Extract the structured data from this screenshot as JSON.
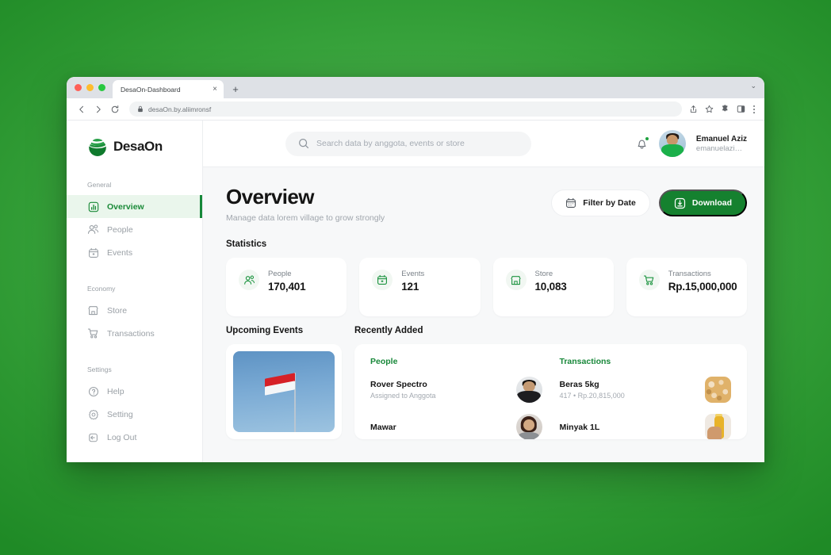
{
  "browser": {
    "tab_title": "DesaOn-Dashboard",
    "tab_close": "×",
    "new_tab": "+",
    "tabstrip_chevron": "⌄",
    "url": "desaOn.by.aliimronsf",
    "icons": {
      "back": "back-arrow-icon",
      "forward": "forward-arrow-icon",
      "reload": "reload-icon",
      "lock": "lock-icon",
      "share": "share-icon",
      "bookmark": "star-icon",
      "extensions": "puzzle-icon",
      "sidepanel": "side-panel-icon",
      "menu": "kebab-menu-icon"
    }
  },
  "brand": {
    "name": "DesaOn",
    "logo_color": "#17883a"
  },
  "sidebar": {
    "groups": [
      {
        "label": "General",
        "items": [
          {
            "label": "Overview",
            "icon": "chart-bar-icon",
            "active": true
          },
          {
            "label": "People",
            "icon": "people-icon",
            "active": false
          },
          {
            "label": "Events",
            "icon": "calendar-icon",
            "active": false
          }
        ]
      },
      {
        "label": "Economy",
        "items": [
          {
            "label": "Store",
            "icon": "store-icon",
            "active": false
          },
          {
            "label": "Transactions",
            "icon": "cart-icon",
            "active": false
          }
        ]
      },
      {
        "label": "Settings",
        "items": [
          {
            "label": "Help",
            "icon": "question-circle-icon",
            "active": false
          },
          {
            "label": "Setting",
            "icon": "gear-icon",
            "active": false
          },
          {
            "label": "Log Out",
            "icon": "logout-icon",
            "active": false
          }
        ]
      }
    ]
  },
  "topbar": {
    "search_placeholder": "Search data by anggota, events or store",
    "search_icon": "search-icon",
    "notification_icon": "bell-icon",
    "user": {
      "name": "Emanuel Aziz",
      "handle": "emanuelazi…"
    }
  },
  "page": {
    "title": "Overview",
    "subtitle": "Manage data  lorem village to grow strongly",
    "filter_button": "Filter by Date",
    "download_button": "Download",
    "statistics_title": "Statistics"
  },
  "statistics": [
    {
      "label": "People",
      "value": "170,401",
      "icon": "people-icon"
    },
    {
      "label": "Events",
      "value": "121",
      "icon": "calendar-icon"
    },
    {
      "label": "Store",
      "value": "10,083",
      "icon": "store-icon"
    },
    {
      "label": "Transactions",
      "value": "Rp.15,000,000",
      "icon": "cart-icon"
    }
  ],
  "upcoming_events": {
    "title": "Upcoming Events",
    "image_alt": "indonesian-flag-photo"
  },
  "recently_added": {
    "title": "Recently Added",
    "columns": [
      {
        "title": "People",
        "rows": [
          {
            "name": "Rover Spectro",
            "sub": "Assigned to Anggota",
            "thumb": "person-photo"
          },
          {
            "name": "Mawar",
            "sub": "",
            "thumb": "person-photo"
          }
        ]
      },
      {
        "title": "Transactions",
        "rows": [
          {
            "name": "Beras 5kg",
            "sub": "417 • Rp.20,815,000",
            "thumb": "rice-photo"
          },
          {
            "name": "Minyak 1L",
            "sub": "",
            "thumb": "oil-photo"
          }
        ]
      }
    ]
  },
  "colors": {
    "brand_green": "#17883a",
    "primary_button": "#15812f",
    "active_nav_bg": "#eaf6ec",
    "desktop_gradient": "#3aa33e"
  }
}
